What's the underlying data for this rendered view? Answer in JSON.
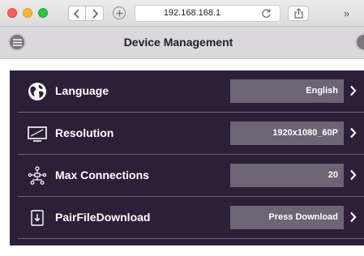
{
  "browser": {
    "url": "192.168.168.1",
    "icons": {
      "back": "chevron-left-icon",
      "forward": "chevron-right-icon",
      "new_tab": "plus-icon",
      "reload": "reload-icon",
      "share": "share-icon",
      "more": "double-chevron-icon"
    },
    "more_label": "»"
  },
  "header": {
    "title": "Device Management",
    "icons": {
      "menu": "menu-icon",
      "user": "user-icon"
    }
  },
  "settings": {
    "rows": [
      {
        "label": "Language",
        "value": "English",
        "icon": "globe-icon"
      },
      {
        "label": "Resolution",
        "value": "1920x1080_60P",
        "icon": "monitor-icon"
      },
      {
        "label": "Max Connections",
        "value": "20",
        "icon": "network-icon"
      },
      {
        "label": "PairFileDownload",
        "value": "Press Download",
        "icon": "download-file-icon"
      }
    ]
  },
  "colors": {
    "panel_background": "#2c1f37",
    "value_box": "#6d6574",
    "header_background": "#dad8dd",
    "traffic_red": "#fc5f57",
    "traffic_yellow": "#fdbb2e",
    "traffic_green": "#28c840"
  }
}
